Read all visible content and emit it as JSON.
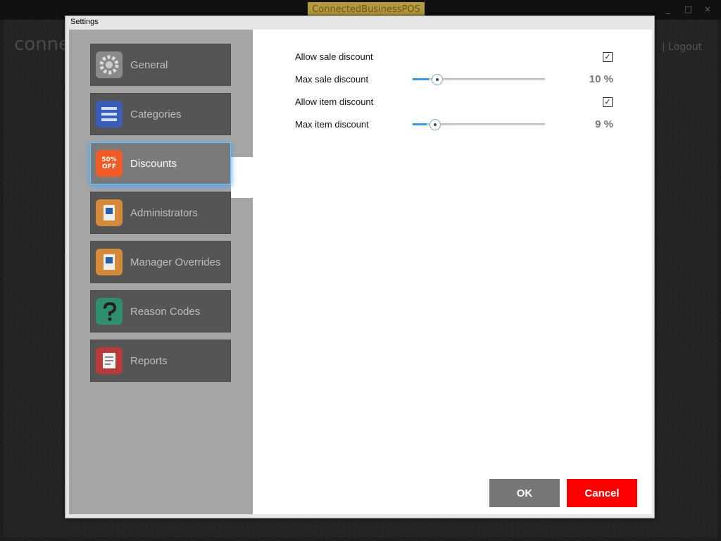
{
  "app": {
    "title": "ConnectedBusinessPOS",
    "logo_text": "conne",
    "logout": "| Logout",
    "minimize": "_",
    "maximize": "□",
    "close": "×"
  },
  "dialog": {
    "title": "Settings"
  },
  "sidebar": {
    "items": [
      {
        "label": "General",
        "icon": "gear-icon",
        "color": "#8a8a8a"
      },
      {
        "label": "Categories",
        "icon": "list-icon",
        "color": "#3a5eb8"
      },
      {
        "label": "Discounts",
        "icon": "discount-tag-icon",
        "color": "#f05a24",
        "active": true,
        "badge": "50% OFF"
      },
      {
        "label": "Administrators",
        "icon": "id-badge-icon",
        "color": "#d58a3a"
      },
      {
        "label": "Manager Overrides",
        "icon": "id-badge-icon",
        "color": "#d58a3a"
      },
      {
        "label": "Reason Codes",
        "icon": "question-mark-icon",
        "color": "#2e8e6e"
      },
      {
        "label": "Reports",
        "icon": "report-icon",
        "color": "#b83a3a"
      }
    ]
  },
  "settings": {
    "allow_sale_discount": {
      "label": "Allow sale discount",
      "checked": true,
      "mark": "✓"
    },
    "max_sale_discount": {
      "label": "Max sale discount",
      "value_text": "10 %",
      "value": 10,
      "max": 100
    },
    "allow_item_discount": {
      "label": "Allow item discount",
      "checked": true,
      "mark": "✓"
    },
    "max_item_discount": {
      "label": "Max item discount",
      "value_text": "9 %",
      "value": 9,
      "max": 100
    }
  },
  "buttons": {
    "ok": "OK",
    "cancel": "Cancel"
  },
  "colors": {
    "accent": "#3a9be0",
    "cancel": "#ff0000",
    "ok": "#777777"
  }
}
